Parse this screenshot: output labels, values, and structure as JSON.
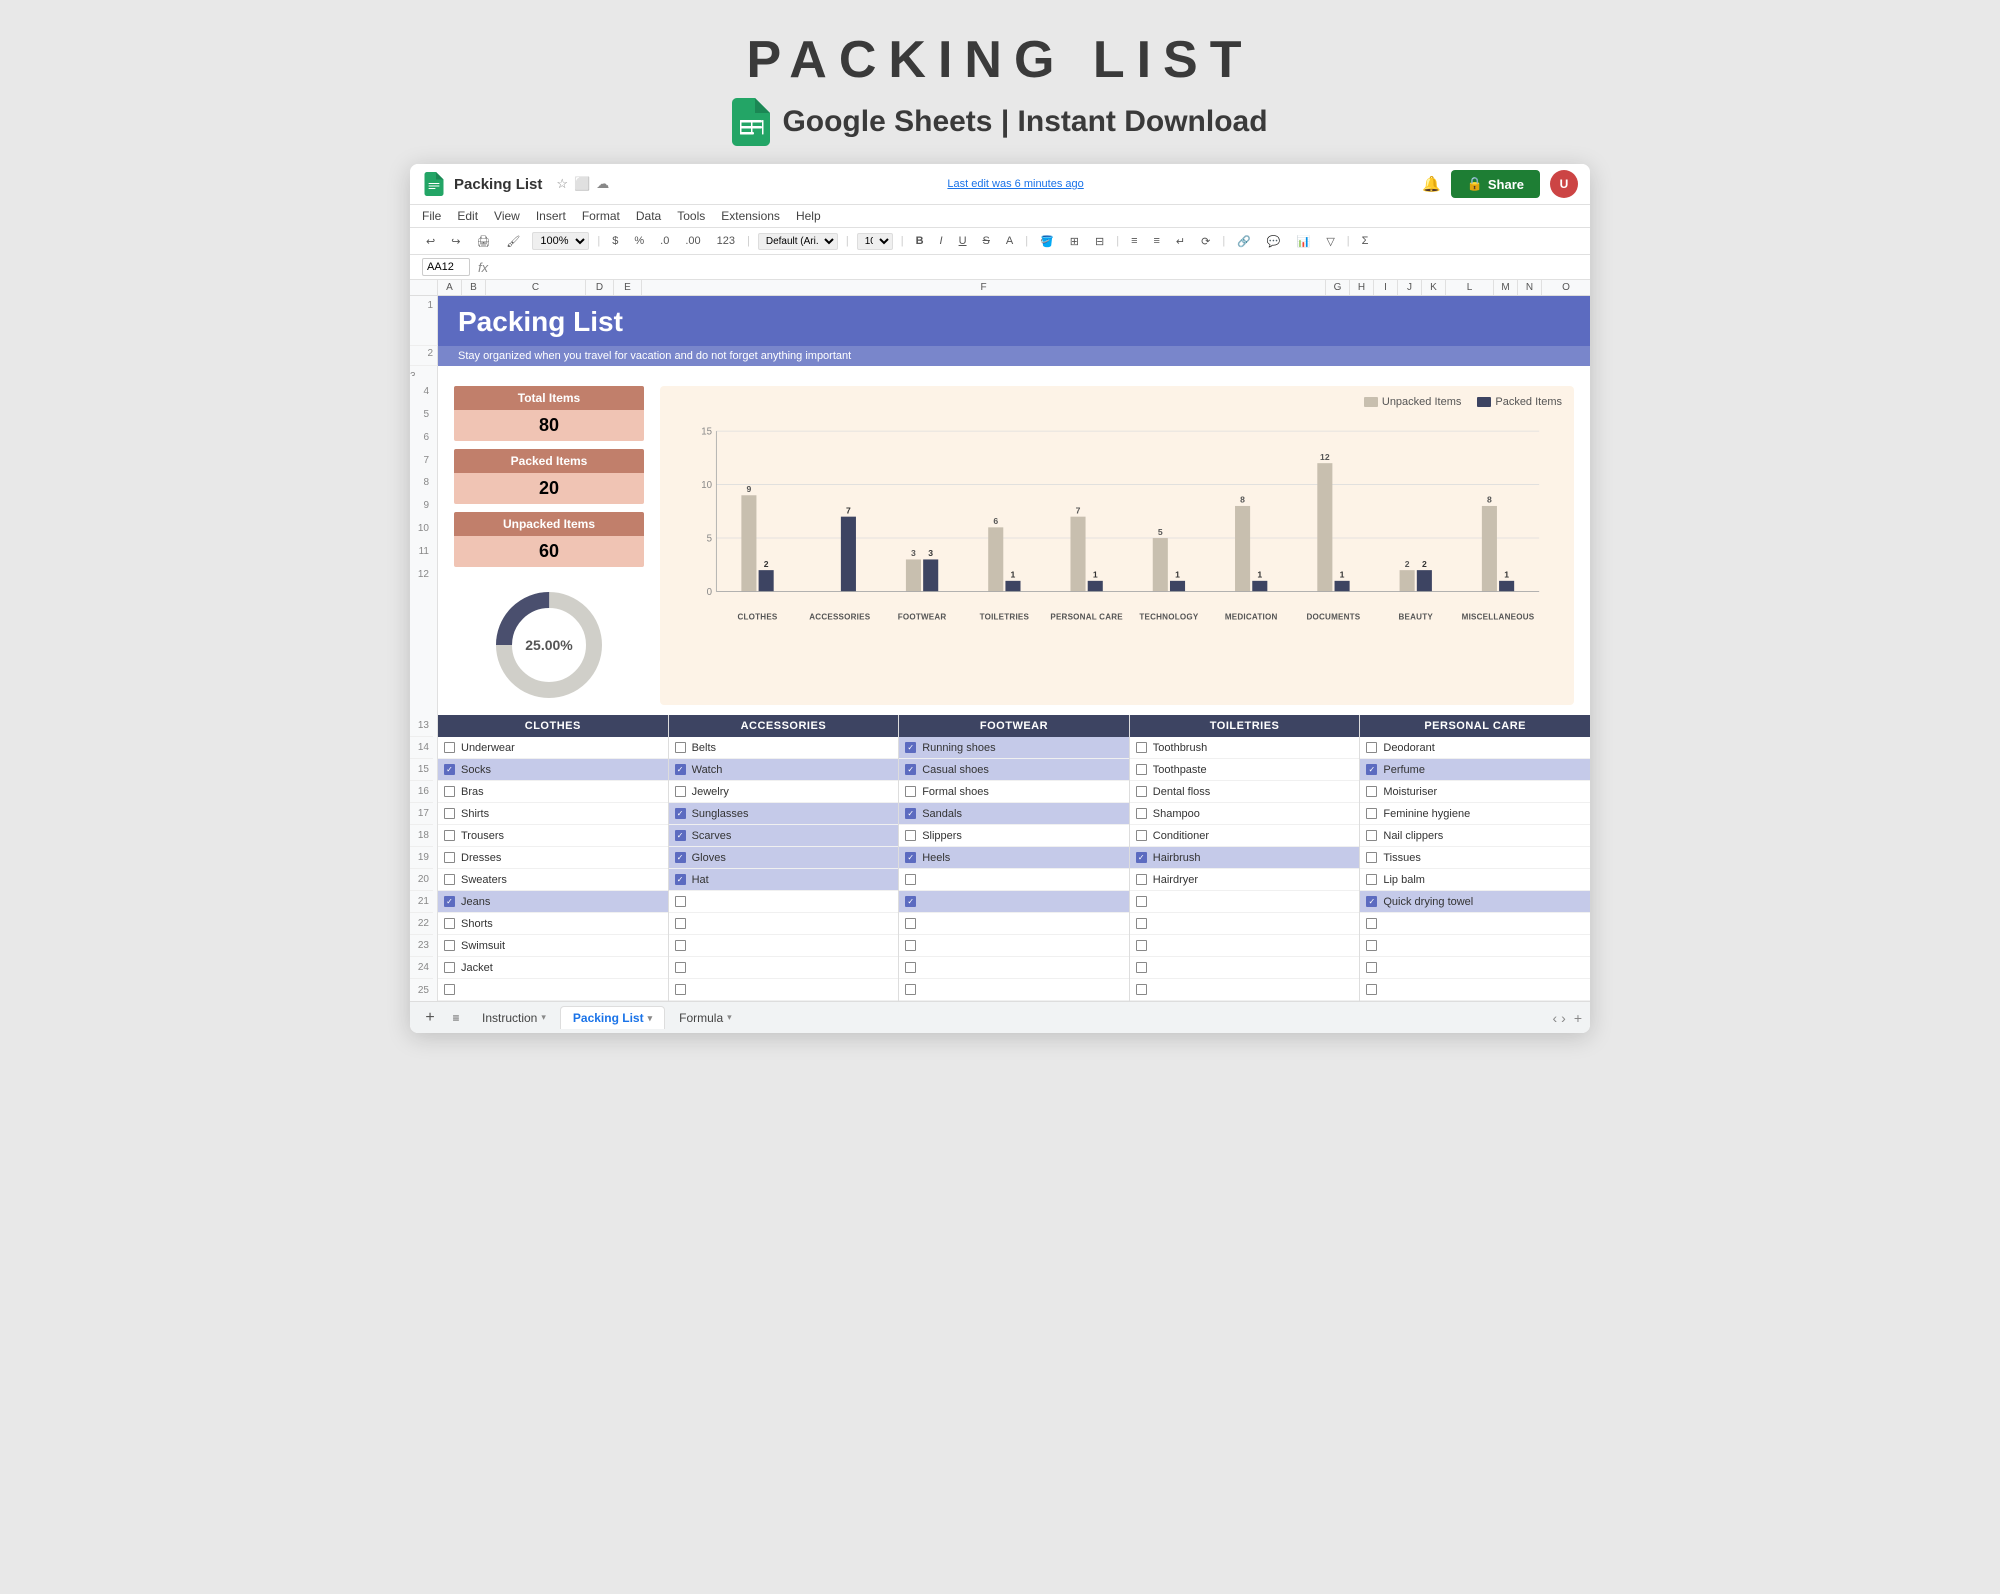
{
  "page": {
    "title": "PACKING LIST",
    "subtitle": "Google Sheets | Instant Download"
  },
  "spreadsheet": {
    "filename": "Packing List",
    "last_edit": "Last edit was 6 minutes ago",
    "cell_ref": "AA12",
    "share_label": "Share",
    "menu_items": [
      "File",
      "Edit",
      "View",
      "Insert",
      "Format",
      "Data",
      "Tools",
      "Extensions",
      "Help"
    ],
    "zoom": "100%",
    "font": "Default (Ari...",
    "font_size": "10"
  },
  "sheet_header": {
    "title": "Packing List",
    "subtitle": "Stay organized when you travel for vacation and do not forget anything important"
  },
  "stats": {
    "total_items_label": "Total Items",
    "total_items_value": "80",
    "packed_items_label": "Packed Items",
    "packed_items_value": "20",
    "unpacked_items_label": "Unpacked Items",
    "unpacked_items_value": "60",
    "percentage": "25.00%"
  },
  "chart": {
    "legend_unpacked": "Unpacked Items",
    "legend_packed": "Packed Items",
    "y_max": 15,
    "categories": [
      {
        "name": "CLOTHES",
        "unpacked": 9,
        "packed": 2
      },
      {
        "name": "ACCESSORIES",
        "unpacked": 0,
        "packed": 7
      },
      {
        "name": "FOOTWEAR",
        "unpacked": 3,
        "packed": 3
      },
      {
        "name": "TOILETRIES",
        "unpacked": 6,
        "packed": 1
      },
      {
        "name": "PERSONAL CARE",
        "unpacked": 7,
        "packed": 1
      },
      {
        "name": "TECHNOLOGY",
        "unpacked": 5,
        "packed": 1
      },
      {
        "name": "MEDICATION",
        "unpacked": 8,
        "packed": 1
      },
      {
        "name": "DOCUMENTS",
        "unpacked": 12,
        "packed": 1
      },
      {
        "name": "BEAUTY",
        "unpacked": 2,
        "packed": 2
      },
      {
        "name": "MISCELLANEOUS",
        "unpacked": 8,
        "packed": 1
      }
    ]
  },
  "columns": [
    {
      "header": "CLOTHES",
      "items": [
        {
          "name": "Underwear",
          "checked": false
        },
        {
          "name": "Socks",
          "checked": true
        },
        {
          "name": "Bras",
          "checked": false
        },
        {
          "name": "Shirts",
          "checked": false
        },
        {
          "name": "Trousers",
          "checked": false
        },
        {
          "name": "Dresses",
          "checked": false
        },
        {
          "name": "Sweaters",
          "checked": false
        },
        {
          "name": "Jeans",
          "checked": true
        },
        {
          "name": "Shorts",
          "checked": false
        },
        {
          "name": "Swimsuit",
          "checked": false
        },
        {
          "name": "Jacket",
          "checked": false
        },
        {
          "name": "",
          "checked": false
        }
      ]
    },
    {
      "header": "ACCESSORIES",
      "items": [
        {
          "name": "Belts",
          "checked": false
        },
        {
          "name": "Watch",
          "checked": true
        },
        {
          "name": "Jewelry",
          "checked": false
        },
        {
          "name": "Sunglasses",
          "checked": true
        },
        {
          "name": "Scarves",
          "checked": true
        },
        {
          "name": "Gloves",
          "checked": true
        },
        {
          "name": "Hat",
          "checked": true
        },
        {
          "name": "",
          "checked": false
        },
        {
          "name": "",
          "checked": false
        },
        {
          "name": "",
          "checked": false
        },
        {
          "name": "",
          "checked": false
        },
        {
          "name": "",
          "checked": false
        }
      ]
    },
    {
      "header": "FOOTWEAR",
      "items": [
        {
          "name": "Running shoes",
          "checked": true
        },
        {
          "name": "Casual shoes",
          "checked": true
        },
        {
          "name": "Formal shoes",
          "checked": false
        },
        {
          "name": "Sandals",
          "checked": true
        },
        {
          "name": "Slippers",
          "checked": false
        },
        {
          "name": "Heels",
          "checked": true
        },
        {
          "name": "",
          "checked": false
        },
        {
          "name": "",
          "checked": true
        },
        {
          "name": "",
          "checked": false
        },
        {
          "name": "",
          "checked": false
        },
        {
          "name": "",
          "checked": false
        },
        {
          "name": "",
          "checked": false
        }
      ]
    },
    {
      "header": "TOILETRIES",
      "items": [
        {
          "name": "Toothbrush",
          "checked": false
        },
        {
          "name": "Toothpaste",
          "checked": false
        },
        {
          "name": "Dental floss",
          "checked": false
        },
        {
          "name": "Shampoo",
          "checked": false
        },
        {
          "name": "Conditioner",
          "checked": false
        },
        {
          "name": "Hairbrush",
          "checked": true
        },
        {
          "name": "Hairdryer",
          "checked": false
        },
        {
          "name": "",
          "checked": false
        },
        {
          "name": "",
          "checked": false
        },
        {
          "name": "",
          "checked": false
        },
        {
          "name": "",
          "checked": false
        },
        {
          "name": "",
          "checked": false
        }
      ]
    },
    {
      "header": "PERSONAL CARE",
      "items": [
        {
          "name": "Deodorant",
          "checked": false
        },
        {
          "name": "Perfume",
          "checked": true
        },
        {
          "name": "Moisturiser",
          "checked": false
        },
        {
          "name": "Feminine hygiene",
          "checked": false
        },
        {
          "name": "Nail clippers",
          "checked": false
        },
        {
          "name": "Tissues",
          "checked": false
        },
        {
          "name": "Lip balm",
          "checked": false
        },
        {
          "name": "Quick drying towel",
          "checked": true
        },
        {
          "name": "",
          "checked": false
        },
        {
          "name": "",
          "checked": false
        },
        {
          "name": "",
          "checked": false
        },
        {
          "name": "",
          "checked": false
        }
      ]
    }
  ],
  "tabs": [
    {
      "name": "Instruction",
      "active": false
    },
    {
      "name": "Packing List",
      "active": true
    },
    {
      "name": "Formula",
      "active": false
    }
  ]
}
